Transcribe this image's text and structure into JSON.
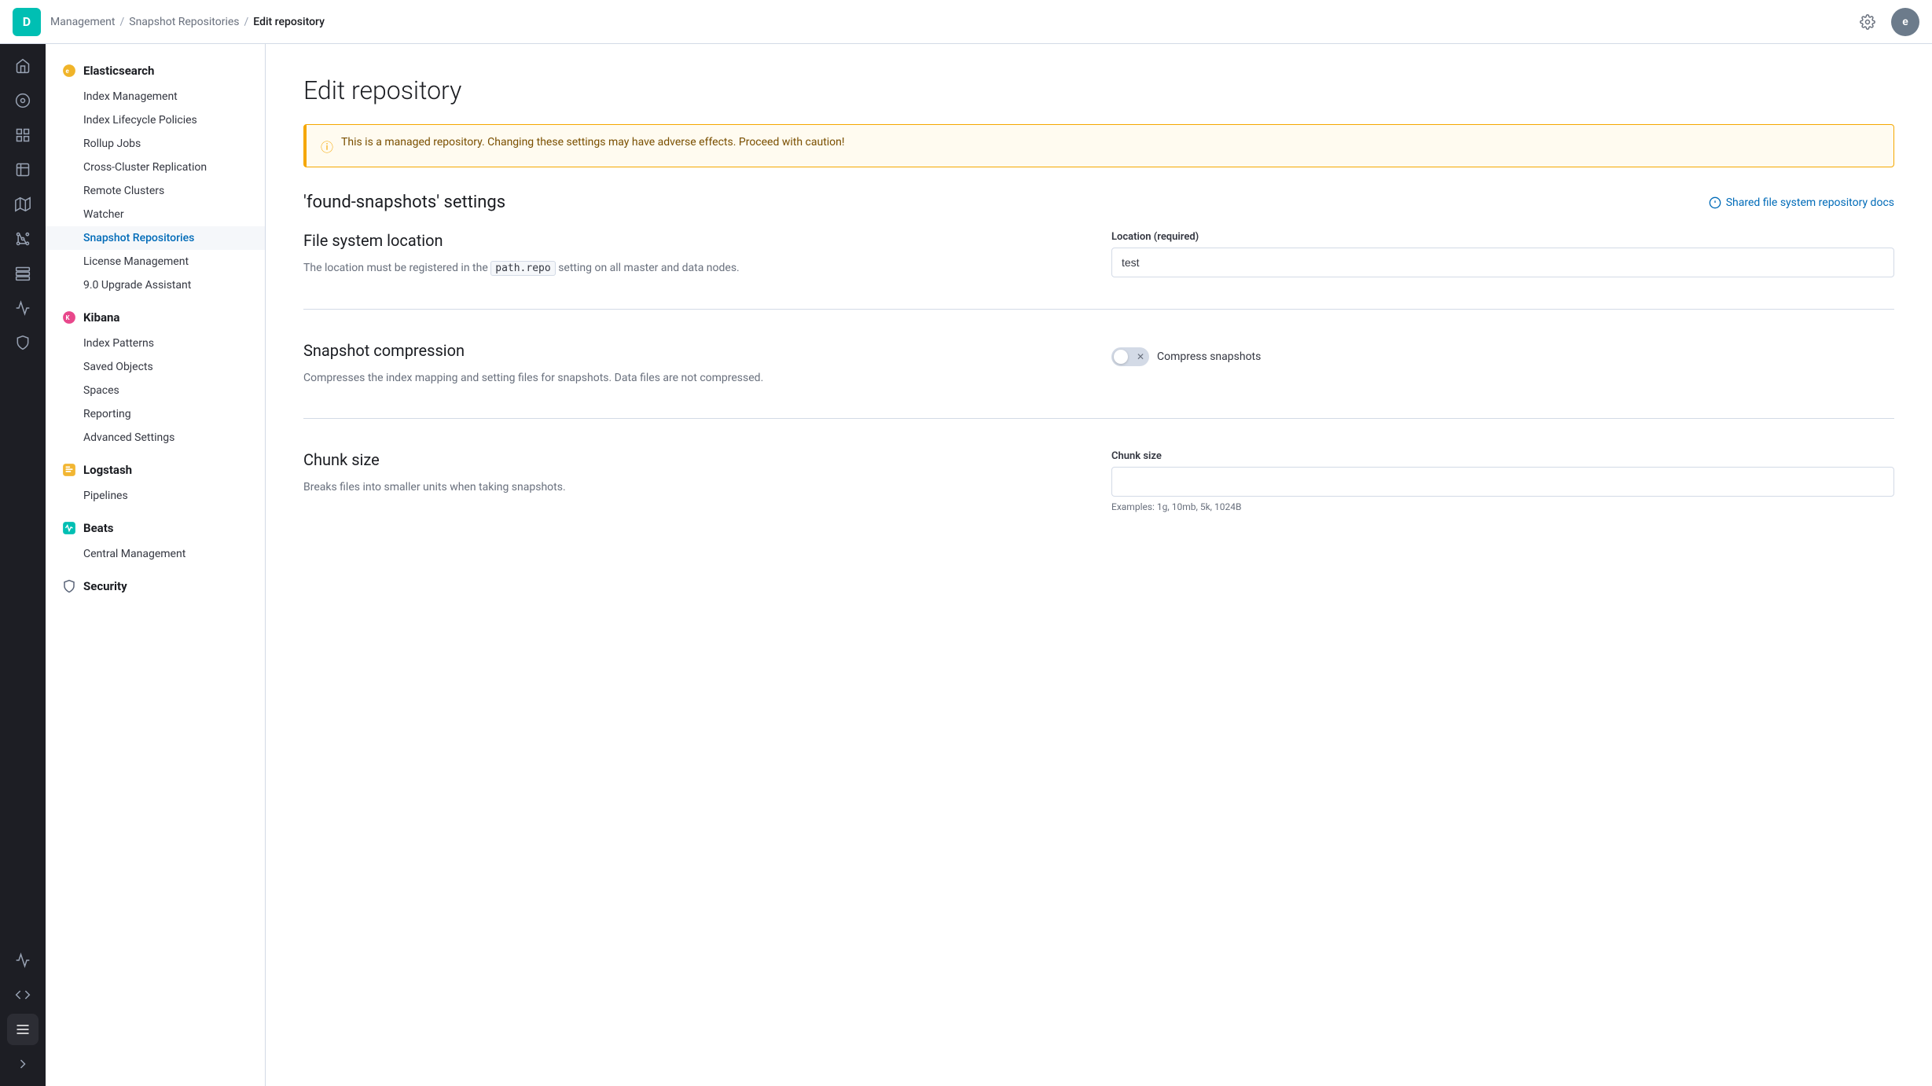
{
  "topnav": {
    "logo_letter": "D",
    "breadcrumbs": [
      {
        "label": "Management",
        "link": true
      },
      {
        "label": "Snapshot Repositories",
        "link": true
      },
      {
        "label": "Edit repository",
        "link": false
      }
    ],
    "avatar_letter": "e"
  },
  "sidebar": {
    "elasticsearch_header": "Elasticsearch",
    "elasticsearch_items": [
      "Index Management",
      "Index Lifecycle Policies",
      "Rollup Jobs",
      "Cross-Cluster Replication",
      "Remote Clusters",
      "Watcher",
      "Snapshot Repositories",
      "License Management",
      "9.0 Upgrade Assistant"
    ],
    "kibana_header": "Kibana",
    "kibana_items": [
      "Index Patterns",
      "Saved Objects",
      "Spaces",
      "Reporting",
      "Advanced Settings"
    ],
    "logstash_header": "Logstash",
    "logstash_items": [
      "Pipelines"
    ],
    "beats_header": "Beats",
    "beats_items": [
      "Central Management"
    ],
    "security_header": "Security"
  },
  "page": {
    "title": "Edit repository",
    "warning_text": "This is a managed repository. Changing these settings may have adverse effects. Proceed with caution!",
    "settings_section_title": "'found-snapshots' settings",
    "docs_link_label": "Shared file system repository docs",
    "file_system": {
      "section_title": "File system location",
      "description_prefix": "The location must be registered in the",
      "code": "path.repo",
      "description_suffix": "setting on all master and data nodes.",
      "field_label": "Location (required)",
      "field_value": "test"
    },
    "snapshot_compression": {
      "section_title": "Snapshot compression",
      "description": "Compresses the index mapping and setting files for snapshots. Data files are not compressed.",
      "checkbox_label": "Compress snapshots"
    },
    "chunk_size": {
      "section_title": "Chunk size",
      "description": "Breaks files into smaller units when taking snapshots.",
      "field_label": "Chunk size",
      "field_value": "",
      "field_hint": "Examples: 1g, 10mb, 5k, 1024B"
    }
  }
}
